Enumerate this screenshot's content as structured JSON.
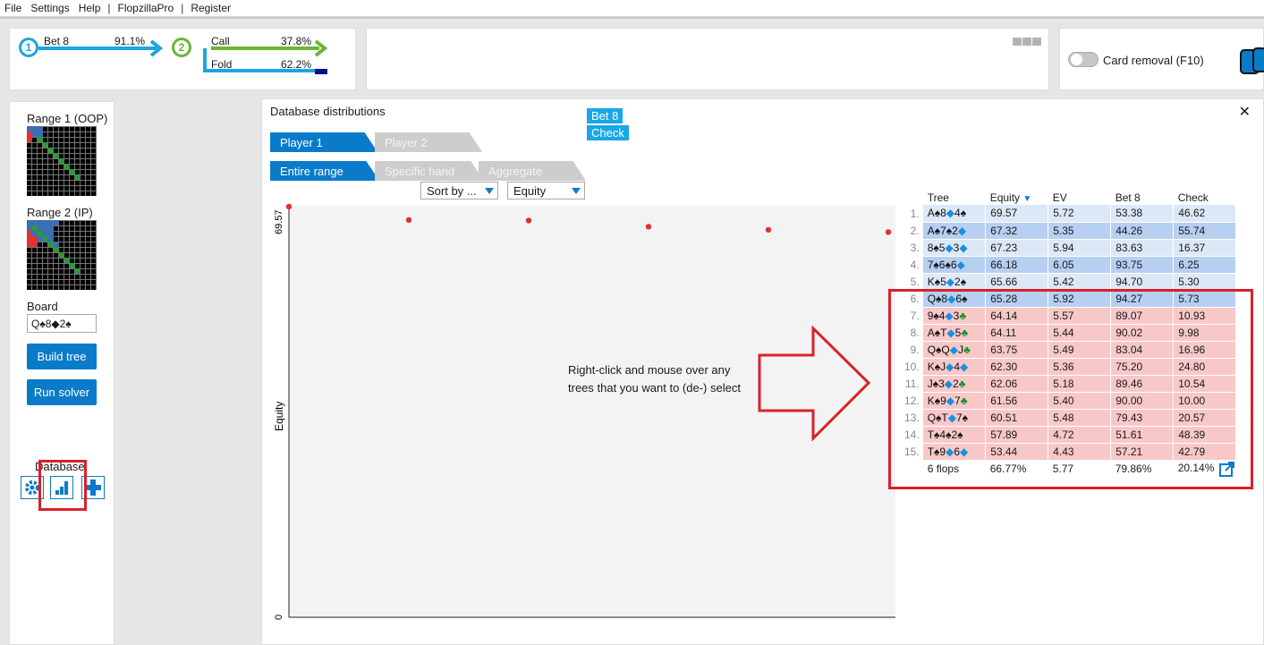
{
  "menu": [
    "File",
    "Settings",
    "Help",
    "|",
    "FlopzillaPro",
    "|",
    "Register"
  ],
  "action_flow": {
    "node1": "1",
    "node1_action": "Bet 8",
    "node1_pct": "91.1%",
    "node2": "2",
    "node2_actions": [
      {
        "label": "Call",
        "pct": "37.8%"
      },
      {
        "label": "Fold",
        "pct": "62.2%"
      }
    ]
  },
  "card_removal": {
    "label": "Card removal (F10)",
    "enabled": false
  },
  "sidebar": {
    "range1_label": "Range 1 (OOP)",
    "range2_label": "Range 2 (IP)",
    "board_label": "Board",
    "board_value": "Q♠8◆2♠",
    "build_tree": "Build tree",
    "run_solver": "Run solver",
    "database_label": "Database:"
  },
  "dialog": {
    "title": "Database distributions",
    "close": "✕",
    "legend": [
      "Bet 8",
      "Check"
    ],
    "player_tabs": [
      {
        "label": "Player 1",
        "active": true
      },
      {
        "label": "Player 2",
        "active": false
      }
    ],
    "scope_tabs": [
      {
        "label": "Entire range",
        "active": true
      },
      {
        "label": "Specific hand",
        "active": false
      },
      {
        "label": "Aggregate",
        "active": false
      }
    ],
    "sort_select": "Sort by ...",
    "metric_select": "Equity"
  },
  "chart_data": {
    "type": "scatter",
    "ylabel": "Equity",
    "ylim": [
      0,
      69.57
    ],
    "yticks": [
      "69.57",
      "0"
    ],
    "points": [
      {
        "x": 1,
        "y": 69.57
      },
      {
        "x": 2,
        "y": 67.32
      },
      {
        "x": 3,
        "y": 67.23
      },
      {
        "x": 4,
        "y": 66.18
      },
      {
        "x": 5,
        "y": 65.66
      },
      {
        "x": 6,
        "y": 65.28
      }
    ],
    "x_max": 6,
    "point_color": "#e03030"
  },
  "table": {
    "headers": [
      "Tree",
      "Equity",
      "EV",
      "Bet 8",
      "Check"
    ],
    "sorted_column": "Equity",
    "rows": [
      {
        "n": "1.",
        "tree": [
          [
            "A",
            "sp"
          ],
          [
            "♠",
            "sp"
          ],
          [
            "8",
            "sp"
          ],
          [
            "◆",
            "hd"
          ],
          [
            "4",
            "sp"
          ],
          [
            "♠",
            "sp"
          ]
        ],
        "equity": "69.57",
        "ev": "5.72",
        "bet": "53.38",
        "check": "46.62",
        "style": "blue1"
      },
      {
        "n": "2.",
        "tree": [
          [
            "A",
            "sp"
          ],
          [
            "♠",
            "sp"
          ],
          [
            "7",
            "sp"
          ],
          [
            "♠",
            "sp"
          ],
          [
            "2",
            "sp"
          ],
          [
            "◆",
            "hd"
          ]
        ],
        "equity": "67.32",
        "ev": "5.35",
        "bet": "44.26",
        "check": "55.74",
        "style": "blue2"
      },
      {
        "n": "3.",
        "tree": [
          [
            "8",
            "sp"
          ],
          [
            "♠",
            "sp"
          ],
          [
            "5",
            "sp"
          ],
          [
            "◆",
            "hd"
          ],
          [
            "3",
            "sp"
          ],
          [
            "◆",
            "hd"
          ]
        ],
        "equity": "67.23",
        "ev": "5.94",
        "bet": "83.63",
        "check": "16.37",
        "style": "blue1"
      },
      {
        "n": "4.",
        "tree": [
          [
            "7",
            "sp"
          ],
          [
            "♠",
            "sp"
          ],
          [
            "6",
            "sp"
          ],
          [
            "♠",
            "sp"
          ],
          [
            "6",
            "sp"
          ],
          [
            "◆",
            "hd"
          ]
        ],
        "equity": "66.18",
        "ev": "6.05",
        "bet": "93.75",
        "check": "6.25",
        "style": "blue2"
      },
      {
        "n": "5.",
        "tree": [
          [
            "K",
            "sp"
          ],
          [
            "♠",
            "sp"
          ],
          [
            "5",
            "sp"
          ],
          [
            "◆",
            "hd"
          ],
          [
            "2",
            "sp"
          ],
          [
            "♠",
            "sp"
          ]
        ],
        "equity": "65.66",
        "ev": "5.42",
        "bet": "94.70",
        "check": "5.30",
        "style": "blue1"
      },
      {
        "n": "6.",
        "tree": [
          [
            "Q",
            "sp"
          ],
          [
            "♠",
            "sp"
          ],
          [
            "8",
            "sp"
          ],
          [
            "◆",
            "hd"
          ],
          [
            "6",
            "sp"
          ],
          [
            "♠",
            "sp"
          ]
        ],
        "equity": "65.28",
        "ev": "5.92",
        "bet": "94.27",
        "check": "5.73",
        "style": "blue2"
      },
      {
        "n": "7.",
        "tree": [
          [
            "9",
            "sp"
          ],
          [
            "♠",
            "sp"
          ],
          [
            "4",
            "sp"
          ],
          [
            "◆",
            "hd"
          ],
          [
            "3",
            "sp"
          ],
          [
            "♣",
            "cl"
          ]
        ],
        "equity": "64.14",
        "ev": "5.57",
        "bet": "89.07",
        "check": "10.93",
        "style": "pink"
      },
      {
        "n": "8.",
        "tree": [
          [
            "A",
            "sp"
          ],
          [
            "♠",
            "sp"
          ],
          [
            "T",
            "sp"
          ],
          [
            "◆",
            "hd"
          ],
          [
            "5",
            "sp"
          ],
          [
            "♣",
            "cl"
          ]
        ],
        "equity": "64.11",
        "ev": "5.44",
        "bet": "90.02",
        "check": "9.98",
        "style": "pink"
      },
      {
        "n": "9.",
        "tree": [
          [
            "Q",
            "sp"
          ],
          [
            "♠",
            "sp"
          ],
          [
            "Q",
            "sp"
          ],
          [
            "◆",
            "hd"
          ],
          [
            "J",
            "sp"
          ],
          [
            "♣",
            "cl"
          ]
        ],
        "equity": "63.75",
        "ev": "5.49",
        "bet": "83.04",
        "check": "16.96",
        "style": "pink"
      },
      {
        "n": "10.",
        "tree": [
          [
            "K",
            "sp"
          ],
          [
            "♠",
            "sp"
          ],
          [
            "J",
            "sp"
          ],
          [
            "◆",
            "hd"
          ],
          [
            "4",
            "sp"
          ],
          [
            "◆",
            "hd"
          ]
        ],
        "equity": "62.30",
        "ev": "5.36",
        "bet": "75.20",
        "check": "24.80",
        "style": "pink"
      },
      {
        "n": "11.",
        "tree": [
          [
            "J",
            "sp"
          ],
          [
            "♠",
            "sp"
          ],
          [
            "3",
            "sp"
          ],
          [
            "◆",
            "hd"
          ],
          [
            "2",
            "sp"
          ],
          [
            "♣",
            "cl"
          ]
        ],
        "equity": "62.06",
        "ev": "5.18",
        "bet": "89.46",
        "check": "10.54",
        "style": "pink"
      },
      {
        "n": "12.",
        "tree": [
          [
            "K",
            "sp"
          ],
          [
            "♠",
            "sp"
          ],
          [
            "9",
            "sp"
          ],
          [
            "◆",
            "hd"
          ],
          [
            "7",
            "sp"
          ],
          [
            "♣",
            "cl"
          ]
        ],
        "equity": "61.56",
        "ev": "5.40",
        "bet": "90.00",
        "check": "10.00",
        "style": "pink"
      },
      {
        "n": "13.",
        "tree": [
          [
            "Q",
            "sp"
          ],
          [
            "♠",
            "sp"
          ],
          [
            "T",
            "sp"
          ],
          [
            "◆",
            "hd"
          ],
          [
            "7",
            "sp"
          ],
          [
            "♠",
            "sp"
          ]
        ],
        "equity": "60.51",
        "ev": "5.48",
        "bet": "79.43",
        "check": "20.57",
        "style": "pink"
      },
      {
        "n": "14.",
        "tree": [
          [
            "T",
            "sp"
          ],
          [
            "♠",
            "sp"
          ],
          [
            "4",
            "sp"
          ],
          [
            "♠",
            "sp"
          ],
          [
            "2",
            "sp"
          ],
          [
            "♠",
            "sp"
          ]
        ],
        "equity": "57.89",
        "ev": "4.72",
        "bet": "51.61",
        "check": "48.39",
        "style": "pink"
      },
      {
        "n": "15.",
        "tree": [
          [
            "T",
            "sp"
          ],
          [
            "♠",
            "sp"
          ],
          [
            "9",
            "sp"
          ],
          [
            "◆",
            "hd"
          ],
          [
            "6",
            "sp"
          ],
          [
            "◆",
            "hd"
          ]
        ],
        "equity": "53.44",
        "ev": "4.43",
        "bet": "57.21",
        "check": "42.79",
        "style": "pink"
      }
    ],
    "summary": {
      "tree": "6 flops",
      "equity": "66.77%",
      "ev": "5.77",
      "bet": "79.86%",
      "check": "20.14%"
    }
  },
  "annotation": {
    "text": "Right-click and mouse over any trees that you want to (de-) select",
    "highlight_color": "#d9202a"
  }
}
